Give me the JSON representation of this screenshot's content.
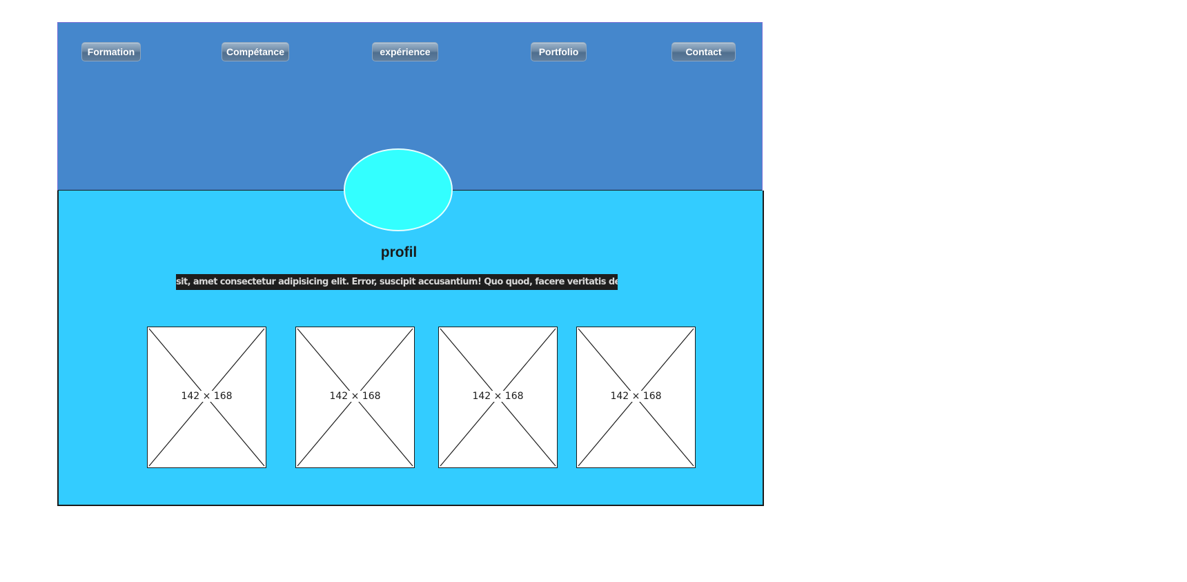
{
  "nav": {
    "items": [
      {
        "label": "Formation"
      },
      {
        "label": "Compétance"
      },
      {
        "label": "expérience"
      },
      {
        "label": "Portfolio"
      },
      {
        "label": "Contact"
      }
    ]
  },
  "profile": {
    "avatar_icon": "avatar-ellipse",
    "title": "profil",
    "bio": "sit, amet consectetur adipisicing elit. Error, suscipit accusantium! Quo quod, facere veritatis deleniti, nihil,"
  },
  "gallery": {
    "images": [
      {
        "label": "142 × 168"
      },
      {
        "label": "142 × 168"
      },
      {
        "label": "142 × 168"
      },
      {
        "label": "142 × 168"
      }
    ]
  },
  "colors": {
    "header_bg": "#4587cc",
    "main_bg": "#33ccff",
    "avatar_fill": "#33ffff",
    "bio_bg": "#1e1e1e"
  }
}
